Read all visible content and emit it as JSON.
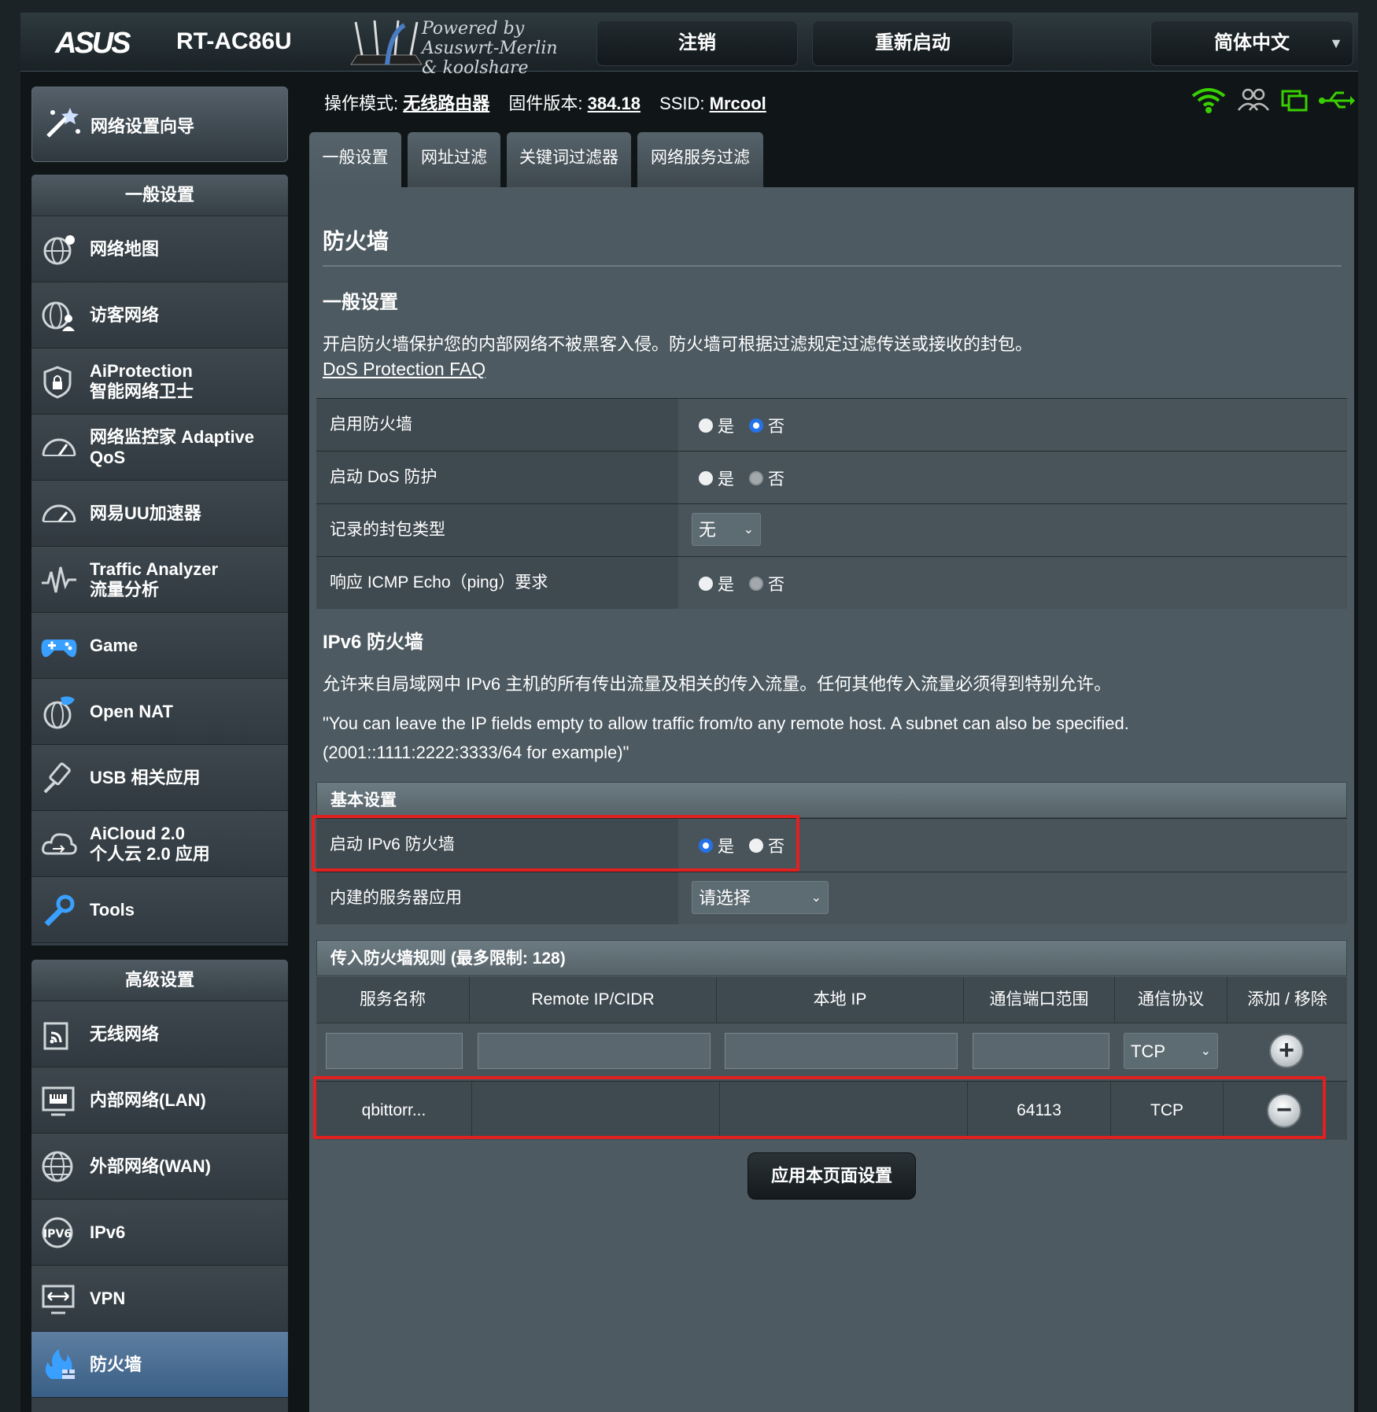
{
  "header": {
    "brand": "ASUS",
    "model": "RT-AC86U",
    "powered_by": [
      "Powered by",
      "Asuswrt-Merlin",
      "& koolshare"
    ],
    "logout": "注销",
    "reboot": "重新启动",
    "language": "简体中文"
  },
  "sidebar": {
    "wizard": "网络设置向导",
    "general_title": "一般设置",
    "general_items": [
      {
        "label": "网络地图",
        "icon": "network-map-icon"
      },
      {
        "label": "访客网络",
        "icon": "guest-network-icon"
      },
      {
        "label": "AiProtection\n智能网络卫士",
        "icon": "aiprotection-icon"
      },
      {
        "label": "网络监控家 Adaptive\nQoS",
        "icon": "qos-gauge-icon"
      },
      {
        "label": "网易UU加速器",
        "icon": "uu-accelerator-icon"
      },
      {
        "label": "Traffic Analyzer\n流量分析",
        "icon": "traffic-analyzer-icon"
      },
      {
        "label": "Game",
        "icon": "gamepad-icon"
      },
      {
        "label": "Open NAT",
        "icon": "open-nat-icon"
      },
      {
        "label": "USB 相关应用",
        "icon": "usb-app-icon"
      },
      {
        "label": "AiCloud 2.0\n个人云 2.0 应用",
        "icon": "aicloud-icon"
      },
      {
        "label": "Tools",
        "icon": "wrench-icon"
      }
    ],
    "advanced_title": "高级设置",
    "advanced_items": [
      {
        "label": "无线网络",
        "icon": "wireless-icon"
      },
      {
        "label": "内部网络(LAN)",
        "icon": "lan-icon"
      },
      {
        "label": "外部网络(WAN)",
        "icon": "wan-globe-icon"
      },
      {
        "label": "IPv6",
        "icon": "ipv6-icon"
      },
      {
        "label": "VPN",
        "icon": "vpn-icon"
      },
      {
        "label": "防火墙",
        "icon": "firewall-icon",
        "active": true
      }
    ]
  },
  "status": {
    "mode_label": "操作模式:",
    "mode_value": "无线路由器",
    "fw_label": "固件版本:",
    "fw_value": "384.18",
    "ssid_label": "SSID:",
    "ssid_value": "Mrcool"
  },
  "tabs": [
    "一般设置",
    "网址过滤",
    "关键词过滤器",
    "网络服务过滤"
  ],
  "main": {
    "title": "防火墙",
    "general_heading": "一般设置",
    "general_desc": "开启防火墙保护您的内部网络不被黑客入侵。防火墙可根据过滤规定过滤传送或接收的封包。",
    "faq_link": "DoS Protection FAQ",
    "settings": [
      {
        "label": "启用防火墙",
        "yes": "是",
        "no": "否"
      },
      {
        "label": "启动 DoS 防护",
        "yes": "是",
        "no": "否"
      },
      {
        "label": "记录的封包类型",
        "select": "无"
      },
      {
        "label": "响应 ICMP Echo（ping）要求",
        "yes": "是",
        "no": "否"
      }
    ],
    "ipv6_heading": "IPv6 防火墙",
    "ipv6_desc": "允许来自局域网中 IPv6 主机的所有传出流量及相关的传入流量。任何其他传入流量必须得到特别允许。",
    "ipv6_note_1": "\"You can leave the IP fields empty to allow traffic from/to any remote host. A subnet can also be specified.",
    "ipv6_note_2": "(2001::1111:2222:3333/64 for example)\"",
    "basic_header": "基本设置",
    "ipv6_enable_label": "启动 IPv6 防火墙",
    "ipv6_yes": "是",
    "ipv6_no": "否",
    "builtin_label": "内建的服务器应用",
    "builtin_select": "请选择",
    "rules_header": "传入防火墙规则 (最多限制:   128)",
    "columns": [
      "服务名称",
      "Remote IP/CIDR",
      "本地 IP",
      "通信端口范围",
      "通信协议",
      "添加 / 移除"
    ],
    "protocol_select": "TCP",
    "rule": {
      "name": "qbittorr...",
      "remote": "",
      "local": "",
      "port": "64113",
      "protocol": "TCP"
    },
    "apply": "应用本页面设置"
  },
  "colors": {
    "accent": "#2572e8",
    "highlight": "#e12020",
    "active_nav": "#3a5f86"
  }
}
